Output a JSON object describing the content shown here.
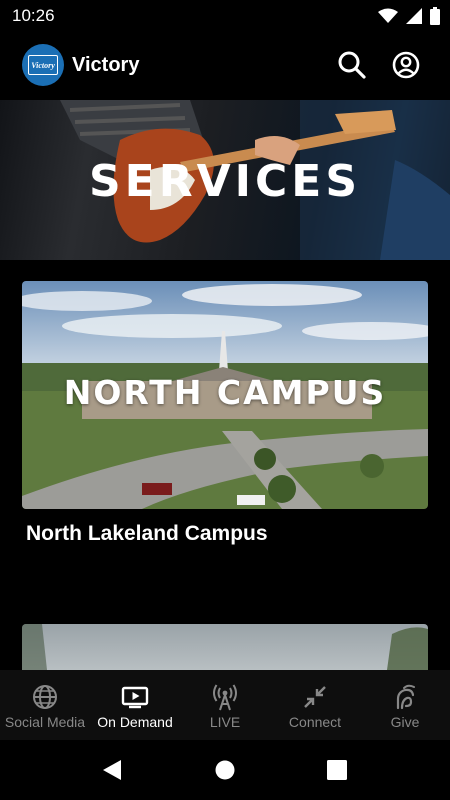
{
  "status": {
    "time": "10:26"
  },
  "app": {
    "title": "Victory",
    "logo_text": "Victory"
  },
  "hero": {
    "title": "SERVICES"
  },
  "cards": [
    {
      "image_title": "NORTH CAMPUS",
      "caption": "North Lakeland Campus"
    }
  ],
  "bottom_nav": [
    {
      "label": "Social Media",
      "icon": "globe-icon"
    },
    {
      "label": "On Demand",
      "icon": "tv-play-icon"
    },
    {
      "label": "LIVE",
      "icon": "broadcast-icon"
    },
    {
      "label": "Connect",
      "icon": "arrows-in-icon"
    },
    {
      "label": "Give",
      "icon": "hand-icon"
    }
  ],
  "colors": {
    "brand": "#1b6fb5",
    "background": "#000000",
    "nav_background": "#0e0e0e",
    "nav_inactive": "#888888"
  }
}
